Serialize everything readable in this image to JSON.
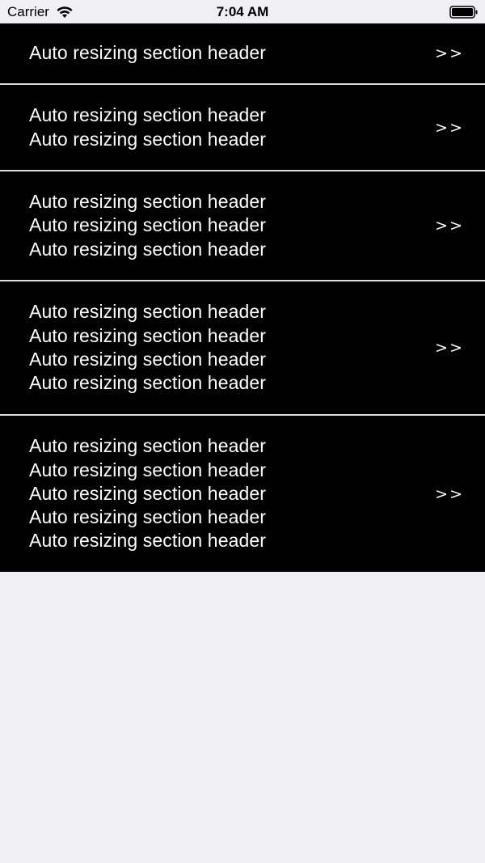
{
  "status_bar": {
    "carrier": "Carrier",
    "time": "7:04 AM",
    "icons": [
      "wifi-icon",
      "battery-icon"
    ]
  },
  "sections": [
    {
      "lines": [
        "Auto resizing section header"
      ],
      "accessory": ">>"
    },
    {
      "lines": [
        "Auto resizing section header",
        "Auto resizing section header"
      ],
      "accessory": ">>"
    },
    {
      "lines": [
        "Auto resizing section header",
        "Auto resizing section header",
        "Auto resizing section header"
      ],
      "accessory": ">>"
    },
    {
      "lines": [
        "Auto resizing section header",
        "Auto resizing section header",
        "Auto resizing section header",
        "Auto resizing section header"
      ],
      "accessory": ">>"
    },
    {
      "lines": [
        "Auto resizing section header",
        "Auto resizing section header",
        "Auto resizing section header",
        "Auto resizing section header",
        "Auto resizing section header"
      ],
      "accessory": ">>"
    }
  ],
  "colors": {
    "header_background": "#000000",
    "header_text": "#ffffff",
    "page_background": "#efeff4",
    "separator": "#dcdce0"
  }
}
